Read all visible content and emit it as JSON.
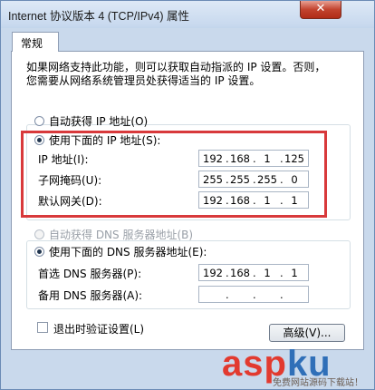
{
  "window": {
    "title": "Internet 协议版本 4 (TCP/IPv4) 属性",
    "close_label": "✕"
  },
  "tabs": [
    {
      "label": "常规"
    }
  ],
  "description": [
    "如果网络支持此功能，则可以获取自动指派的 IP 设置。否则，",
    "您需要从网络系统管理员处获得适当的 IP 设置。"
  ],
  "ip_mode": {
    "auto_label": "自动获得 IP 地址(O)",
    "manual_label": "使用下面的 IP 地址(S):",
    "selected": "manual"
  },
  "ip_fields": {
    "ip": {
      "label": "IP 地址(I):",
      "octets": [
        "192",
        "168",
        "1",
        "125"
      ]
    },
    "mask": {
      "label": "子网掩码(U):",
      "octets": [
        "255",
        "255",
        "255",
        "0"
      ]
    },
    "gateway": {
      "label": "默认网关(D):",
      "octets": [
        "192",
        "168",
        "1",
        "1"
      ]
    }
  },
  "dns_mode": {
    "auto_label": "自动获得 DNS 服务器地址(B)",
    "manual_label": "使用下面的 DNS 服务器地址(E):",
    "selected": "manual"
  },
  "dns_fields": {
    "preferred": {
      "label": "首选 DNS 服务器(P):",
      "octets": [
        "192",
        "168",
        "1",
        "1"
      ]
    },
    "alternate": {
      "label": "备用 DNS 服务器(A):",
      "octets": [
        "",
        "",
        "",
        ""
      ]
    }
  },
  "validate_on_exit": {
    "label": "退出时验证设置(L)",
    "checked": false
  },
  "advanced_button": {
    "label": "高级(V)..."
  },
  "watermark": {
    "main_a": "asp",
    "main_b": "ku",
    "sub": "免费网站源码下载站！"
  },
  "colors": {
    "highlight_box": "#d8393b",
    "accent_blue": "#2f6fb8"
  }
}
